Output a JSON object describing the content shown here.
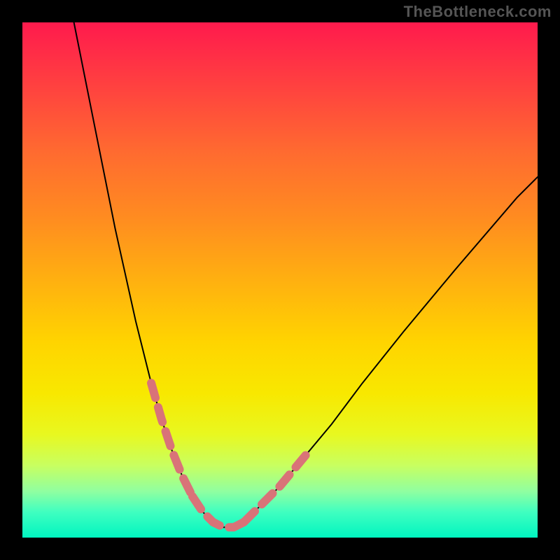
{
  "watermark": "TheBottleneck.com",
  "colors": {
    "frame_bg": "#000000",
    "curve_stroke": "#000000",
    "dash_stroke": "#d97378",
    "gradient_top": "#ff1a4d",
    "gradient_bottom": "#00f5c0"
  },
  "chart_data": {
    "type": "line",
    "title": "",
    "xlabel": "",
    "ylabel": "",
    "xlim": [
      0,
      100
    ],
    "ylim": [
      0,
      100
    ],
    "grid": false,
    "legend": false,
    "annotations": [
      "TheBottleneck.com"
    ],
    "description": "V-shaped bottleneck curve over a vertical red-to-green gradient. Lower y = better (green zone). Left branch descends steeply from top-left to a flat minimum around x 34–42, right branch rises more gradually toward upper right. Salmon dashed overlays mark lower portions of each branch near the minimum.",
    "series": [
      {
        "name": "bottleneck_curve",
        "x": [
          10,
          14,
          18,
          22,
          25,
          27,
          29,
          31,
          33,
          35,
          37,
          39,
          41,
          43,
          46,
          50,
          55,
          60,
          66,
          74,
          84,
          96,
          100
        ],
        "y": [
          100,
          80,
          60,
          42,
          30,
          23,
          17,
          12,
          8,
          5,
          3,
          2,
          2,
          3,
          6,
          10,
          16,
          22,
          30,
          40,
          52,
          66,
          70
        ]
      },
      {
        "name": "left_dash_overlay",
        "x": [
          25,
          27,
          29,
          31,
          33
        ],
        "y": [
          30,
          23,
          17,
          12,
          8
        ]
      },
      {
        "name": "right_dash_overlay",
        "x": [
          43,
          46,
          50,
          55
        ],
        "y": [
          3,
          6,
          10,
          16
        ]
      },
      {
        "name": "minimum_dash_overlay",
        "x": [
          33,
          35,
          37,
          39,
          41,
          43
        ],
        "y": [
          8,
          5,
          3,
          2,
          2,
          3
        ]
      }
    ]
  }
}
